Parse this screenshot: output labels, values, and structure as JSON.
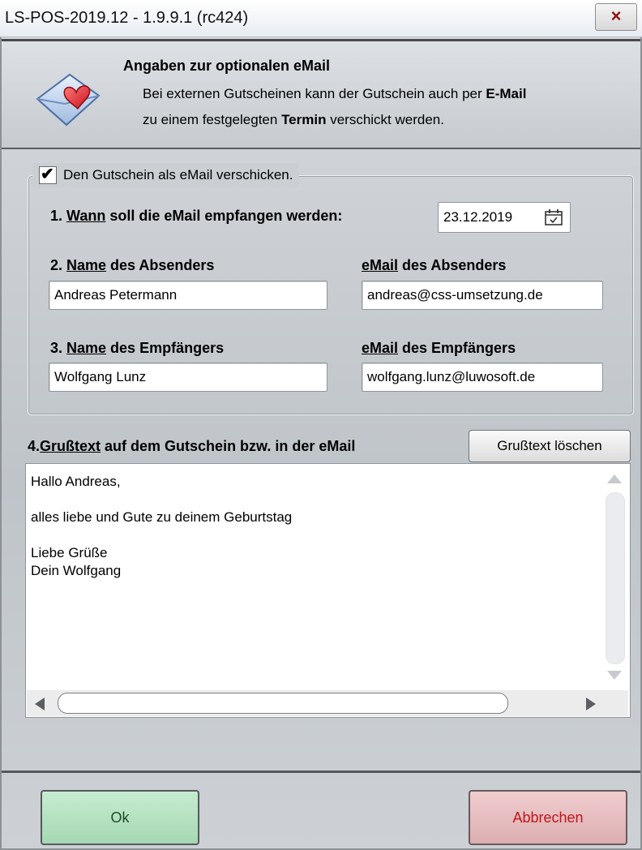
{
  "window": {
    "title": "LS-POS-2019.12 - 1.9.9.1 (rc424)",
    "close_symbol": "×"
  },
  "header": {
    "icon": "envelope-heart-icon",
    "title": "Angaben zur optionalen eMail",
    "line1_pre": "Bei externen Gutscheinen kann der Gutschein auch per ",
    "line1_bold": "E-Mail",
    "line2_pre": "zu einem festgelegten ",
    "line2_bold": "Termin",
    "line2_post": " verschickt werden."
  },
  "send_option": {
    "checked": true,
    "label": "Den Gutschein als eMail verschicken."
  },
  "when": {
    "prefix": "1. ",
    "underlined": "Wann",
    "suffix": " soll die eMail empfangen werden:",
    "date": "23.12.2019",
    "icon": "calendar-icon"
  },
  "sender": {
    "name_prefix": "2. ",
    "name_underlined": "Name",
    "name_suffix": " des Absenders",
    "name_value": "Andreas Petermann",
    "email_underlined": "eMail",
    "email_suffix": " des Absenders",
    "email_value": "andreas@css-umsetzung.de"
  },
  "recipient": {
    "name_prefix": "3. ",
    "name_underlined": "Name",
    "name_suffix": " des Empfängers",
    "name_value": "Wolfgang Lunz",
    "email_underlined": "eMail",
    "email_suffix": " des Empfängers",
    "email_value": "wolfgang.lunz@luwosoft.de"
  },
  "greeting": {
    "prefix": "4.",
    "underlined": "Grußtext",
    "suffix": " auf dem Gutschein bzw. in der eMail",
    "clear_button": "Grußtext löschen",
    "text": "Hallo Andreas,\n\nalles liebe und Gute zu deinem Geburtstag\n\nLiebe Grüße\nDein Wolfgang"
  },
  "footer": {
    "ok_label": "Ok",
    "cancel_label": "Abbrechen"
  },
  "colors": {
    "ok_bg": "#b6e2c1",
    "cancel_bg": "#e6bec1",
    "cancel_text": "#c0161a"
  }
}
